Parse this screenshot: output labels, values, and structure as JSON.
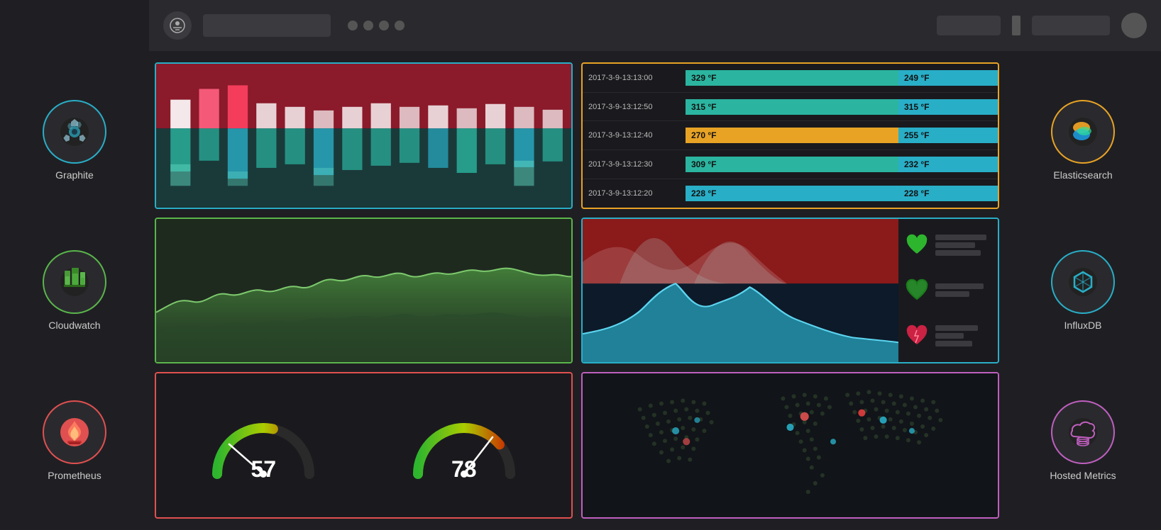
{
  "topbar": {
    "logo_icon": "grafana-logo",
    "search_placeholder": "",
    "dots": 4,
    "btn1": "",
    "btn2": "",
    "avatar": ""
  },
  "left_sidebar": {
    "items": [
      {
        "id": "graphite",
        "label": "Graphite",
        "color": "#29aec7"
      },
      {
        "id": "cloudwatch",
        "label": "Cloudwatch",
        "color": "#5ab54b"
      },
      {
        "id": "prometheus",
        "label": "Prometheus",
        "color": "#e05050"
      }
    ]
  },
  "right_sidebar": {
    "items": [
      {
        "id": "elasticsearch",
        "label": "Elasticsearch",
        "color": "#e8a325"
      },
      {
        "id": "influxdb",
        "label": "InfluxDB",
        "color": "#29aec7"
      },
      {
        "id": "hostedmetrics",
        "label": "Hosted Metrics",
        "color": "#bf5fbf"
      }
    ]
  },
  "panels": {
    "table": {
      "rows": [
        {
          "time": "2017-3-9-13:13:00",
          "val1": "329 °F",
          "val2": "249 °F",
          "color1": "#2bb5a0",
          "color2": "#29aec7"
        },
        {
          "time": "2017-3-9-13:12:50",
          "val1": "315 °F",
          "val2": "315 °F",
          "color1": "#2bb5a0",
          "color2": "#29aec7"
        },
        {
          "time": "2017-3-9-13:12:40",
          "val1": "270 °F",
          "val2": "255 °F",
          "color1": "#e8a325",
          "color2": "#29aec7"
        },
        {
          "time": "2017-3-9-13:12:30",
          "val1": "309 °F",
          "val2": "232 °F",
          "color1": "#2bb5a0",
          "color2": "#29aec7"
        },
        {
          "time": "2017-3-9-13:12:20",
          "val1": "228 °F",
          "val2": "228 °F",
          "color1": "#29aec7",
          "color2": "#29aec7"
        }
      ]
    },
    "gauge1": {
      "value": 57
    },
    "gauge2": {
      "value": 78
    }
  }
}
